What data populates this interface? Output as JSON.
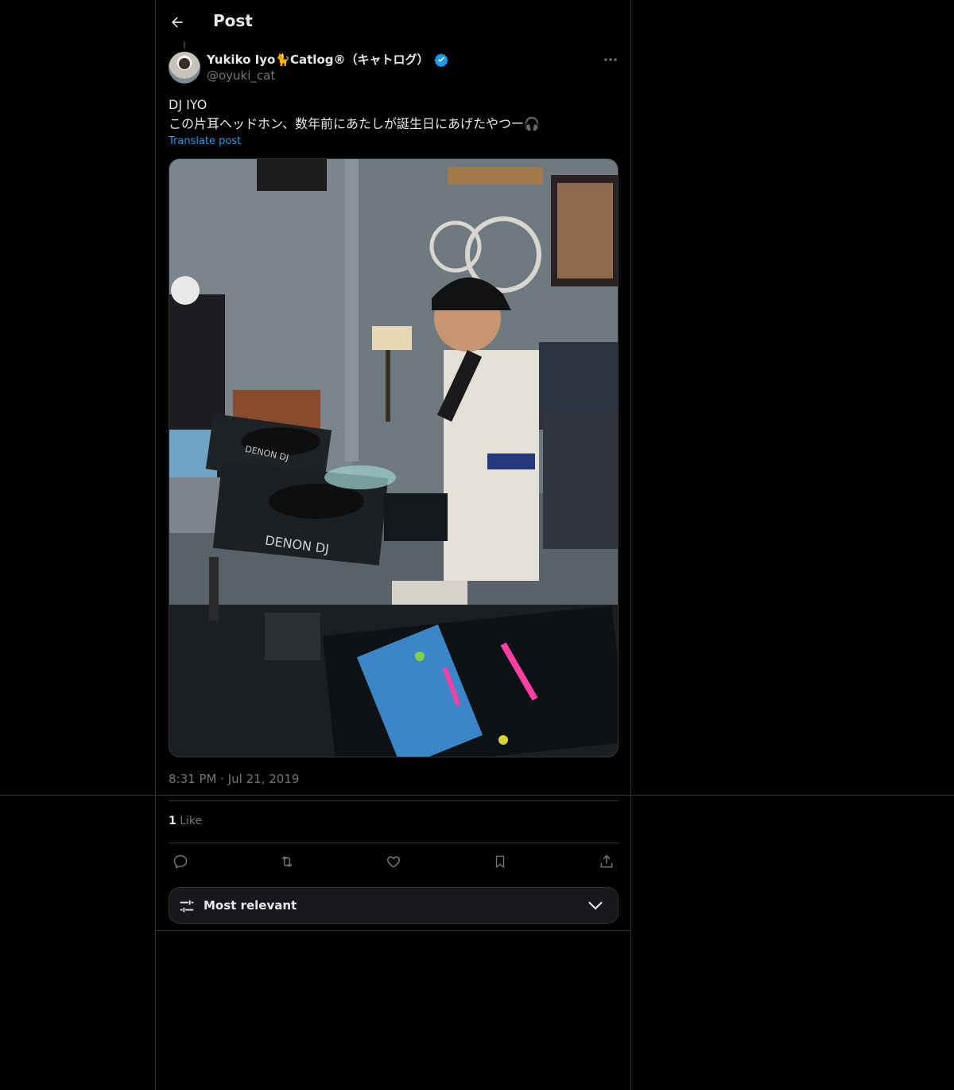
{
  "header": {
    "title": "Post"
  },
  "author": {
    "display_name": "Yukiko Iyo🐈Catlog®（キャトログ）",
    "handle": "@oyuki_cat",
    "verified": true
  },
  "post": {
    "text": "DJ IYO\nこの片耳ヘッドホン、数年前にあたしが誕生日にあげたやつー🎧",
    "translate_label": "Translate post",
    "timestamp": "8:31 PM · Jul 21, 2019"
  },
  "stats": {
    "likes_count": "1",
    "likes_label": "Like"
  },
  "actions": {
    "icons": [
      "reply-icon",
      "repost-icon",
      "like-icon",
      "bookmark-icon",
      "share-icon"
    ]
  },
  "sort": {
    "label": "Most relevant"
  },
  "colors": {
    "accent": "#1d9bf0",
    "muted": "#71767b",
    "border": "#2f3336"
  }
}
